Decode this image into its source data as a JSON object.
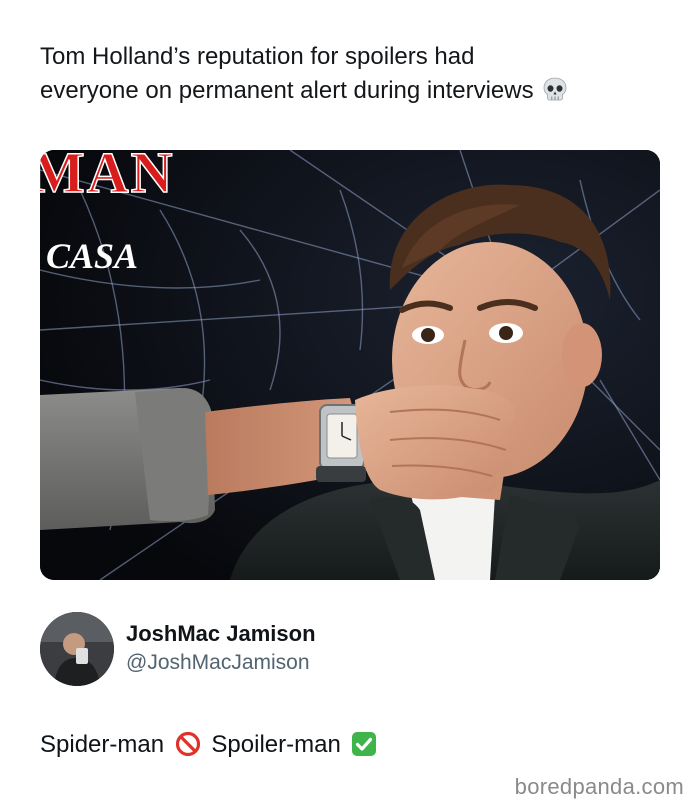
{
  "post": {
    "line1": "Tom Holland’s reputation for spoilers had",
    "line2": "everyone on permanent alert during interviews",
    "emoji": "skull-icon"
  },
  "media": {
    "logo_text": "MAN",
    "brand_text": "CASA"
  },
  "reply": {
    "display_name": "JoshMac Jamison",
    "handle": "@JoshMacJamison",
    "text_part1": "Spider-man",
    "emoji1": "prohibited-icon",
    "text_part2": "Spoiler-man",
    "emoji2": "check-mark-icon"
  },
  "watermark": "boredpanda.com"
}
